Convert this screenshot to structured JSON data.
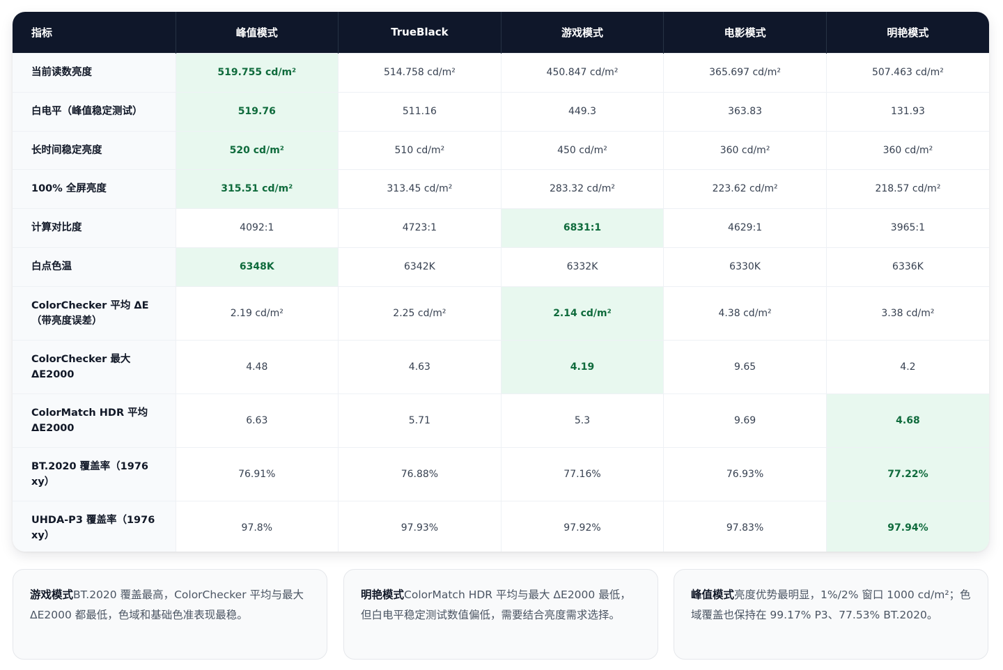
{
  "table": {
    "header": {
      "metric": "指标",
      "modes": [
        "峰值模式",
        "TrueBlack",
        "游戏模式",
        "电影模式",
        "明艳模式"
      ]
    },
    "rows": [
      {
        "label": "当前读数亮度",
        "values": [
          "519.755 cd/m²",
          "514.758 cd/m²",
          "450.847 cd/m²",
          "365.697 cd/m²",
          "507.463 cd/m²"
        ],
        "best_index": 0
      },
      {
        "label": "白电平（峰值稳定测试）",
        "values": [
          "519.76",
          "511.16",
          "449.3",
          "363.83",
          "131.93"
        ],
        "best_index": 0
      },
      {
        "label": "长时间稳定亮度",
        "values": [
          "520 cd/m²",
          "510 cd/m²",
          "450 cd/m²",
          "360 cd/m²",
          "360 cd/m²"
        ],
        "best_index": 0
      },
      {
        "label": "100% 全屏亮度",
        "values": [
          "315.51 cd/m²",
          "313.45 cd/m²",
          "283.32 cd/m²",
          "223.62 cd/m²",
          "218.57 cd/m²"
        ],
        "best_index": 0
      },
      {
        "label": "计算对比度",
        "values": [
          "4092:1",
          "4723:1",
          "6831:1",
          "4629:1",
          "3965:1"
        ],
        "best_index": 2
      },
      {
        "label": "白点色温",
        "values": [
          "6348K",
          "6342K",
          "6332K",
          "6330K",
          "6336K"
        ],
        "best_index": 0
      },
      {
        "label": "ColorChecker 平均 ΔE（带亮度误差）",
        "values": [
          "2.19 cd/m²",
          "2.25 cd/m²",
          "2.14 cd/m²",
          "4.38 cd/m²",
          "3.38 cd/m²"
        ],
        "best_index": 2
      },
      {
        "label": "ColorChecker 最大 ΔE2000",
        "values": [
          "4.48",
          "4.63",
          "4.19",
          "9.65",
          "4.2"
        ],
        "best_index": 2
      },
      {
        "label": "ColorMatch HDR 平均 ΔE2000",
        "values": [
          "6.63",
          "5.71",
          "5.3",
          "9.69",
          "4.68"
        ],
        "best_index": 4
      },
      {
        "label": "BT.2020 覆盖率（1976 xy）",
        "values": [
          "76.91%",
          "76.88%",
          "77.16%",
          "76.93%",
          "77.22%"
        ],
        "best_index": 4
      },
      {
        "label": "UHDA-P3 覆盖率（1976 xy）",
        "values": [
          "97.8%",
          "97.93%",
          "97.92%",
          "97.83%",
          "97.94%"
        ],
        "best_index": 4
      }
    ]
  },
  "notes": [
    {
      "title": "游戏模式",
      "text": "BT.2020 覆盖最高，ColorChecker 平均与最大 ΔE2000 都最低，色域和基础色准表现最稳。"
    },
    {
      "title": "明艳模式",
      "text": "ColorMatch HDR 平均与最大 ΔE2000 最低，但白电平稳定测试数值偏低，需要结合亮度需求选择。"
    },
    {
      "title": "峰值模式",
      "text": "亮度优势最明显，1%/2% 窗口 1000 cd/m²；色域覆盖也保持在 99.17% P3、77.53% BT.2020。"
    }
  ],
  "colors": {
    "header_bg": "#0f172a",
    "best_bg": "#e8f8ef",
    "best_text": "#0f6b3c"
  }
}
